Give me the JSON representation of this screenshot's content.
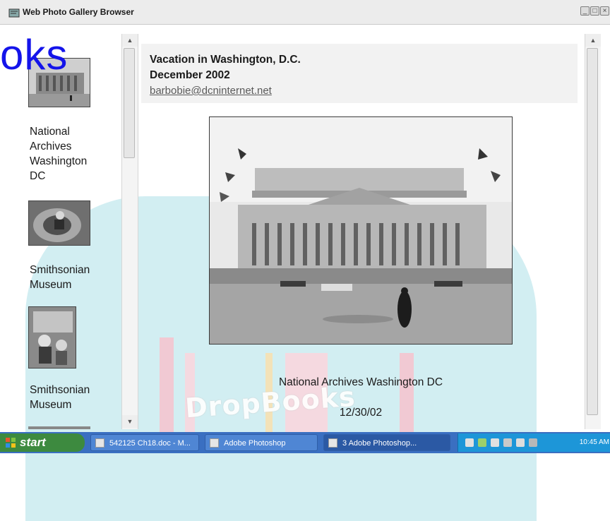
{
  "window": {
    "title": "Web Photo Gallery Browser"
  },
  "watermark": {
    "top_text": "oks",
    "bottom_text": "DropBooks"
  },
  "gallery": {
    "items": [
      {
        "caption_lines": [
          "National",
          "Archives",
          "Washington",
          "DC"
        ]
      },
      {
        "caption_lines": [
          "Smithsonian",
          "Museum"
        ]
      },
      {
        "caption_lines": [
          "Smithsonian",
          "Museum"
        ]
      }
    ]
  },
  "header": {
    "title": "Vacation in Washington, D.C.",
    "date": "December 2002",
    "email": "barbobie@dcninternet.net"
  },
  "photo": {
    "caption": "National Archives Washington DC",
    "date": "12/30/02"
  },
  "taskbar": {
    "start_label": "start",
    "buttons": [
      {
        "label": "542125 Ch18.doc - M..."
      },
      {
        "label": "Adobe Photoshop"
      },
      {
        "label": "3 Adobe Photoshop..."
      }
    ],
    "clock": "10:45 AM"
  }
}
